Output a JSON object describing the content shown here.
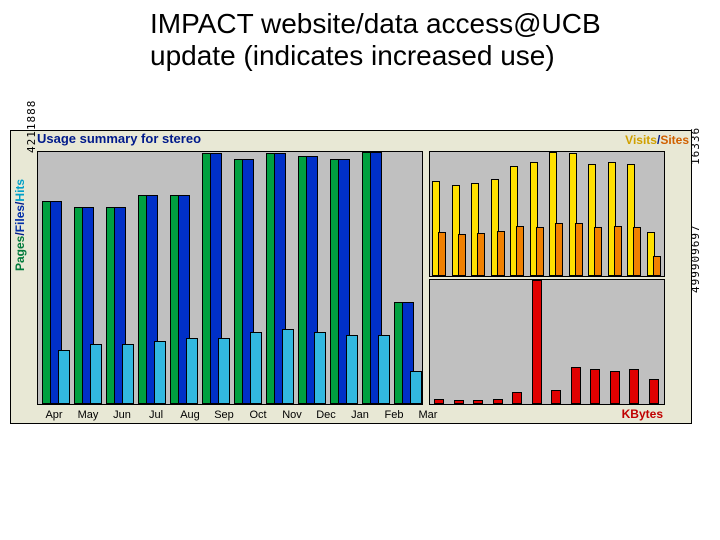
{
  "slide": {
    "title": "IMPACT website/data access@UCB update (indicates increased use)",
    "chart_title": "Usage summary for stereo",
    "legend_right": {
      "visits": "Visits",
      "sep": "/",
      "sites": "Sites"
    },
    "legend_left": {
      "pages": "Pages",
      "files": "Files",
      "hits": "Hits",
      "sep": "/"
    },
    "label_kbytes": "KBytes",
    "num_left_top": "4211888",
    "num_right_top": "16336",
    "num_right_bot": "499909697"
  },
  "chart_data": [
    {
      "type": "bar",
      "title": "Pages / Files / Hits (monthly)",
      "xlabel": "",
      "ylabel": "",
      "ylim": [
        0,
        4211888
      ],
      "categories": [
        "Apr",
        "May",
        "Jun",
        "Jul",
        "Aug",
        "Sep",
        "Oct",
        "Nov",
        "Dec",
        "Jan",
        "Feb",
        "Mar"
      ],
      "series": [
        {
          "name": "Pages",
          "color": "#00a040",
          "values": [
            3400000,
            3300000,
            3300000,
            3500000,
            3500000,
            4200000,
            4100000,
            4200000,
            4150000,
            4100000,
            4211888,
            1700000
          ]
        },
        {
          "name": "Files",
          "color": "#0030c8",
          "values": [
            3400000,
            3300000,
            3300000,
            3500000,
            3500000,
            4200000,
            4100000,
            4200000,
            4150000,
            4100000,
            4211888,
            1700000
          ]
        },
        {
          "name": "Hits",
          "color": "#32b8e0",
          "values": [
            900000,
            1000000,
            1000000,
            1050000,
            1100000,
            1100000,
            1200000,
            1250000,
            1200000,
            1150000,
            1150000,
            550000
          ]
        }
      ]
    },
    {
      "type": "bar",
      "title": "Visits / Sites (monthly)",
      "xlabel": "",
      "ylabel": "",
      "ylim": [
        0,
        16336
      ],
      "categories": [
        "Apr",
        "May",
        "Jun",
        "Jul",
        "Aug",
        "Sep",
        "Oct",
        "Nov",
        "Dec",
        "Jan",
        "Feb",
        "Mar"
      ],
      "series": [
        {
          "name": "Visits",
          "color": "#ffe000",
          "values": [
            12500,
            12000,
            12300,
            12800,
            14500,
            15000,
            16336,
            16200,
            14800,
            15000,
            14800,
            5800
          ]
        },
        {
          "name": "Sites",
          "color": "#f08000",
          "values": [
            5800,
            5600,
            5700,
            5900,
            6600,
            6500,
            7000,
            7000,
            6400,
            6600,
            6500,
            2600
          ]
        }
      ]
    },
    {
      "type": "bar",
      "title": "KBytes (monthly)",
      "xlabel": "",
      "ylabel": "",
      "ylim": [
        0,
        499909697
      ],
      "categories": [
        "Apr",
        "May",
        "Jun",
        "Jul",
        "Aug",
        "Sep",
        "Oct",
        "Nov",
        "Dec",
        "Jan",
        "Feb",
        "Mar"
      ],
      "series": [
        {
          "name": "KBytes",
          "color": "#e00000",
          "values": [
            20000000,
            18000000,
            15000000,
            20000000,
            50000000,
            499909697,
            55000000,
            150000000,
            140000000,
            135000000,
            140000000,
            100000000
          ]
        }
      ]
    }
  ]
}
